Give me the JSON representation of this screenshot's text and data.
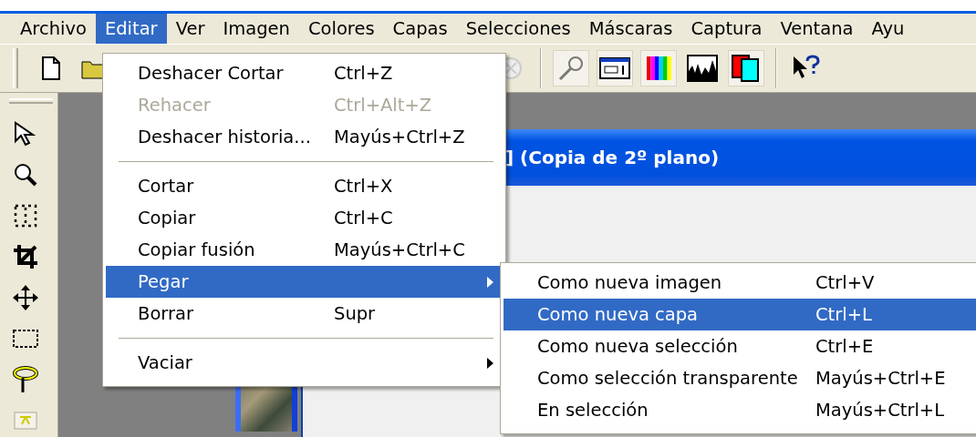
{
  "menubar": [
    {
      "label": "Archivo",
      "selected": false
    },
    {
      "label": "Editar",
      "selected": true
    },
    {
      "label": "Ver",
      "selected": false
    },
    {
      "label": "Imagen",
      "selected": false
    },
    {
      "label": "Colores",
      "selected": false
    },
    {
      "label": "Capas",
      "selected": false
    },
    {
      "label": "Selecciones",
      "selected": false
    },
    {
      "label": "Máscaras",
      "selected": false
    },
    {
      "label": "Captura",
      "selected": false
    },
    {
      "label": "Ventana",
      "selected": false
    },
    {
      "label": "Ayu",
      "selected": false
    }
  ],
  "document": {
    "title": "] (Copia de 2º plano)"
  },
  "edit_menu": {
    "items": [
      {
        "kind": "item",
        "label": "Deshacer Cortar",
        "shortcut": "Ctrl+Z",
        "disabled": false,
        "selected": false,
        "has_submenu": false
      },
      {
        "kind": "item",
        "label": "Rehacer",
        "shortcut": "Ctrl+Alt+Z",
        "disabled": true,
        "selected": false,
        "has_submenu": false
      },
      {
        "kind": "item",
        "label": "Deshacer historia...",
        "shortcut": "Mayús+Ctrl+Z",
        "disabled": false,
        "selected": false,
        "has_submenu": false
      },
      {
        "kind": "separator"
      },
      {
        "kind": "item",
        "label": "Cortar",
        "shortcut": "Ctrl+X",
        "disabled": false,
        "selected": false,
        "has_submenu": false
      },
      {
        "kind": "item",
        "label": "Copiar",
        "shortcut": "Ctrl+C",
        "disabled": false,
        "selected": false,
        "has_submenu": false
      },
      {
        "kind": "item",
        "label": "Copiar fusión",
        "shortcut": "Mayús+Ctrl+C",
        "disabled": false,
        "selected": false,
        "has_submenu": false
      },
      {
        "kind": "item",
        "label": "Pegar",
        "disabled": false,
        "selected": true,
        "has_submenu": true
      },
      {
        "kind": "item",
        "label": "Borrar",
        "shortcut": "Supr",
        "disabled": false,
        "selected": false,
        "has_submenu": false
      },
      {
        "kind": "separator"
      },
      {
        "kind": "item",
        "label": "Vaciar",
        "disabled": false,
        "selected": false,
        "has_submenu": true
      }
    ]
  },
  "paste_submenu": {
    "items": [
      {
        "kind": "item",
        "label": "Como nueva imagen",
        "shortcut": "Ctrl+V",
        "disabled": false,
        "selected": false,
        "has_submenu": false
      },
      {
        "kind": "item",
        "label": "Como nueva capa",
        "shortcut": "Ctrl+L",
        "disabled": false,
        "selected": true,
        "has_submenu": false
      },
      {
        "kind": "item",
        "label": "Como nueva selección",
        "shortcut": "Ctrl+E",
        "disabled": false,
        "selected": false,
        "has_submenu": false
      },
      {
        "kind": "item",
        "label": "Como selección transparente",
        "shortcut": "Mayús+Ctrl+E",
        "disabled": false,
        "selected": false,
        "has_submenu": false
      },
      {
        "kind": "item",
        "label": "En selección",
        "shortcut": "Mayús+Ctrl+L",
        "disabled": false,
        "selected": false,
        "has_submenu": false
      }
    ]
  }
}
